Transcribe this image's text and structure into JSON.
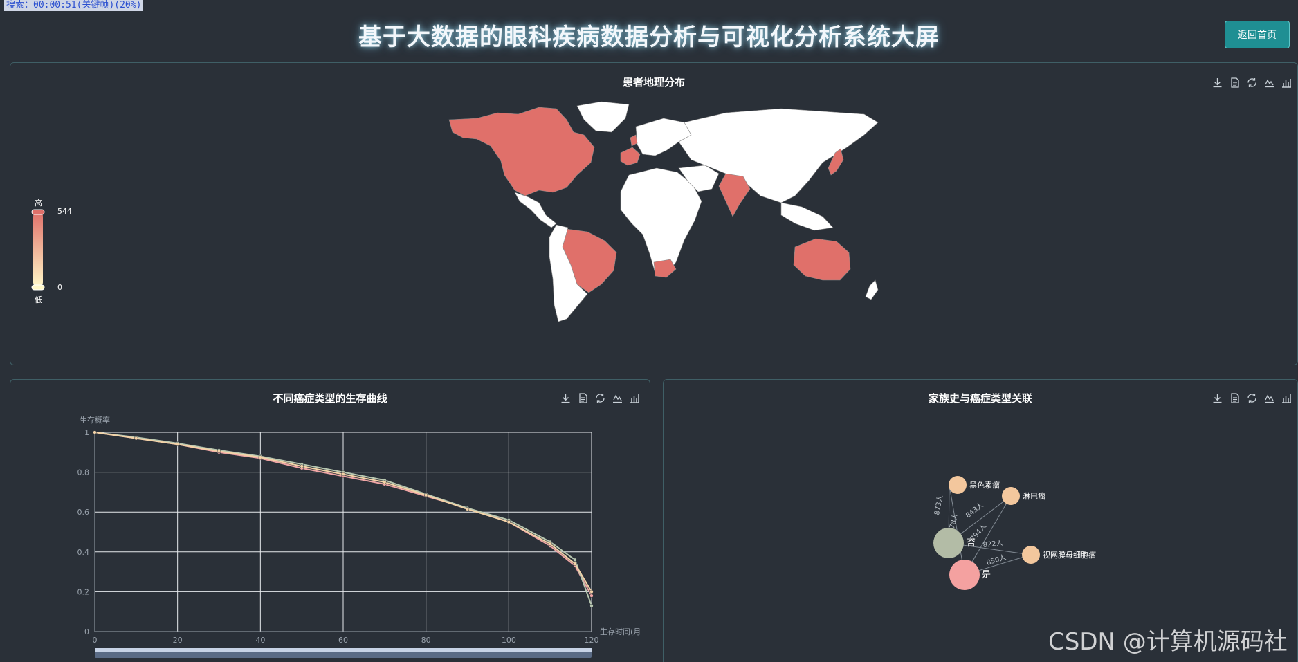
{
  "status_bar": "搜索：00:00:51(关键帧)(20%)",
  "header": {
    "title": "基于大数据的眼科疾病数据分析与可视化分析系统大屏",
    "back_button": "返回首页"
  },
  "map_panel": {
    "title": "患者地理分布",
    "visual_map": {
      "high_label": "高",
      "low_label": "低",
      "max": "544",
      "min": "0"
    },
    "colors": {
      "high": "#e0706a",
      "low": "#fff8c8",
      "none": "#ffffff",
      "ocean": "#2a3038"
    }
  },
  "survival_panel": {
    "title": "不同癌症类型的生存曲线",
    "chart_data": {
      "type": "line",
      "title": "不同癌症类型的生存曲线",
      "ylabel": "生存概率",
      "xlabel": "生存时间(月",
      "xlim": [
        0,
        120
      ],
      "ylim": [
        0,
        1
      ],
      "x_ticks": [
        "0",
        "20",
        "40",
        "60",
        "80",
        "100",
        "120"
      ],
      "y_ticks": [
        "0",
        "0.2",
        "0.4",
        "0.6",
        "0.8",
        "1"
      ],
      "grid": true,
      "series": [
        {
          "color": "#f0a6a6",
          "x": [
            0,
            10,
            20,
            30,
            40,
            50,
            60,
            70,
            80,
            90,
            100,
            110,
            116,
            120
          ],
          "y": [
            1,
            0.97,
            0.94,
            0.9,
            0.87,
            0.82,
            0.78,
            0.74,
            0.68,
            0.62,
            0.55,
            0.43,
            0.33,
            0.18
          ]
        },
        {
          "color": "#b8c7b0",
          "x": [
            0,
            10,
            20,
            30,
            40,
            50,
            60,
            70,
            80,
            90,
            100,
            110,
            116,
            120
          ],
          "y": [
            1,
            0.975,
            0.945,
            0.91,
            0.88,
            0.84,
            0.8,
            0.76,
            0.69,
            0.62,
            0.56,
            0.45,
            0.36,
            0.13
          ]
        },
        {
          "color": "#f3d3a8",
          "x": [
            0,
            10,
            20,
            30,
            40,
            50,
            60,
            70,
            80,
            90,
            100,
            110,
            116,
            120
          ],
          "y": [
            1,
            0.97,
            0.94,
            0.905,
            0.875,
            0.83,
            0.79,
            0.75,
            0.685,
            0.615,
            0.55,
            0.44,
            0.34,
            0.2
          ]
        }
      ]
    }
  },
  "graph_panel": {
    "title": "家族史与癌症类型关联",
    "nodes": [
      {
        "label": "黑色素瘤",
        "color": "#f3c79d"
      },
      {
        "label": "淋巴瘤",
        "color": "#f3c79d"
      },
      {
        "label": "否",
        "color": "#b3bca6"
      },
      {
        "label": "视网膜母细胞瘤",
        "color": "#f3c79d"
      },
      {
        "label": "是",
        "color": "#f4a1a0"
      }
    ],
    "edges": [
      {
        "label": "873人"
      },
      {
        "label": "843人"
      },
      {
        "label": "878人"
      },
      {
        "label": "794人"
      },
      {
        "label": "822人"
      },
      {
        "label": "850人"
      }
    ]
  },
  "watermark": "CSDN @计算机源码社"
}
